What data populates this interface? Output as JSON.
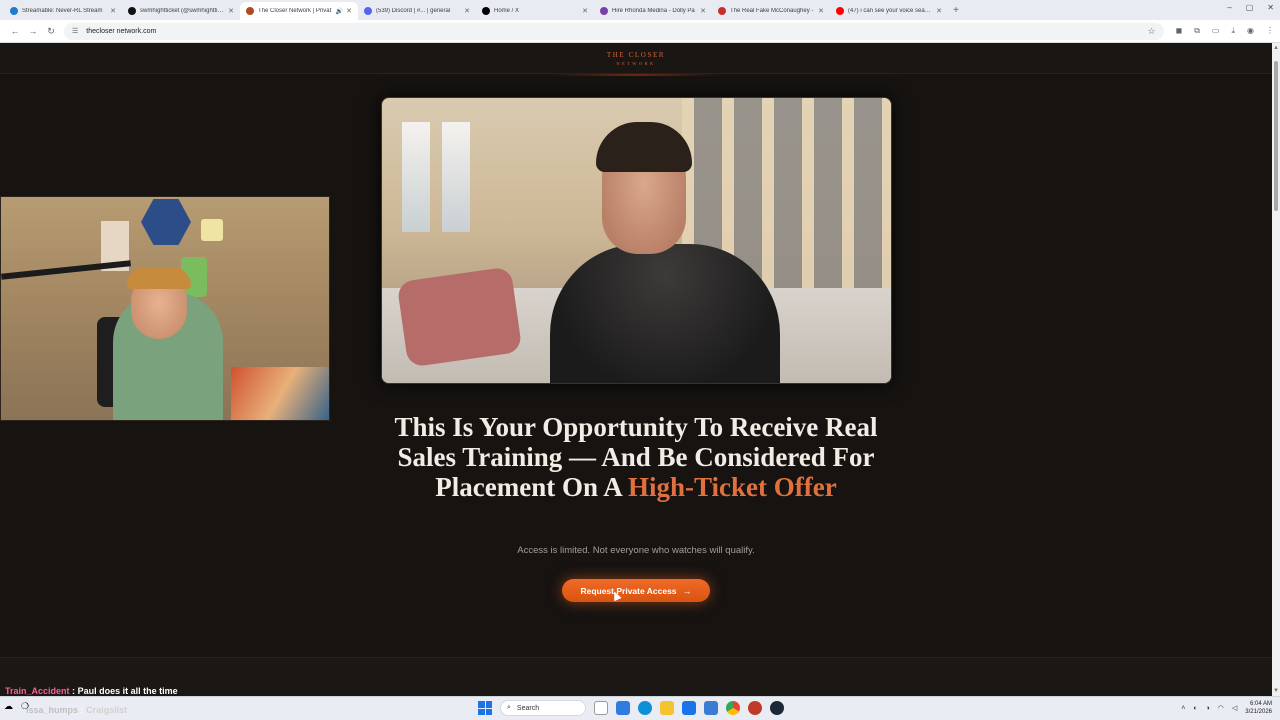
{
  "browser": {
    "tabs": [
      {
        "label": "Streamable: Never-RL Stream",
        "color": "#1f7bd1",
        "active": false
      },
      {
        "label": "swmhightticket (@swmhightticket)",
        "color": "#111111",
        "active": false
      },
      {
        "label": "The Closer Network | Privat",
        "color": "#b34a1f",
        "active": true
      },
      {
        "label": "(539) Discord | #... | general",
        "color": "#5865f2",
        "active": false
      },
      {
        "label": "Home / X",
        "color": "#000000",
        "active": false
      },
      {
        "label": "Hire Rhonda Medina - Dolly Pa",
        "color": "#7b3fa8",
        "active": false
      },
      {
        "label": "The Real Fake McConaughey -",
        "color": "#c9302c",
        "active": false
      },
      {
        "label": "(47) i can see your voice season",
        "color": "#ff0000",
        "active": false
      }
    ],
    "url": "thecloser network.com",
    "url_display": "thecloser network.com"
  },
  "site": {
    "logo_line1": "THE CLOSER",
    "logo_line2": "NETWORK",
    "headline_main": "This Is Your Opportunity To Receive Real Sales Training — And Be Considered For Placement On A ",
    "headline_accent": "High-Ticket Offer",
    "subtext": "Access is limited. Not everyone who watches will qualify.",
    "cta_label": "Request Private Access",
    "cta_arrow": "→",
    "accent_color": "#e0703e",
    "background_color": "#161311"
  },
  "chat": [
    {
      "user": "Train_Accident",
      "sep": ":",
      "message": "Paul does it all the time"
    },
    {
      "user": "issa_humps",
      "sep": ":",
      "message": "Craigslist"
    }
  ],
  "taskbar": {
    "search_label": "Search",
    "time": "6:04 AM",
    "date": "3/21/2026"
  }
}
